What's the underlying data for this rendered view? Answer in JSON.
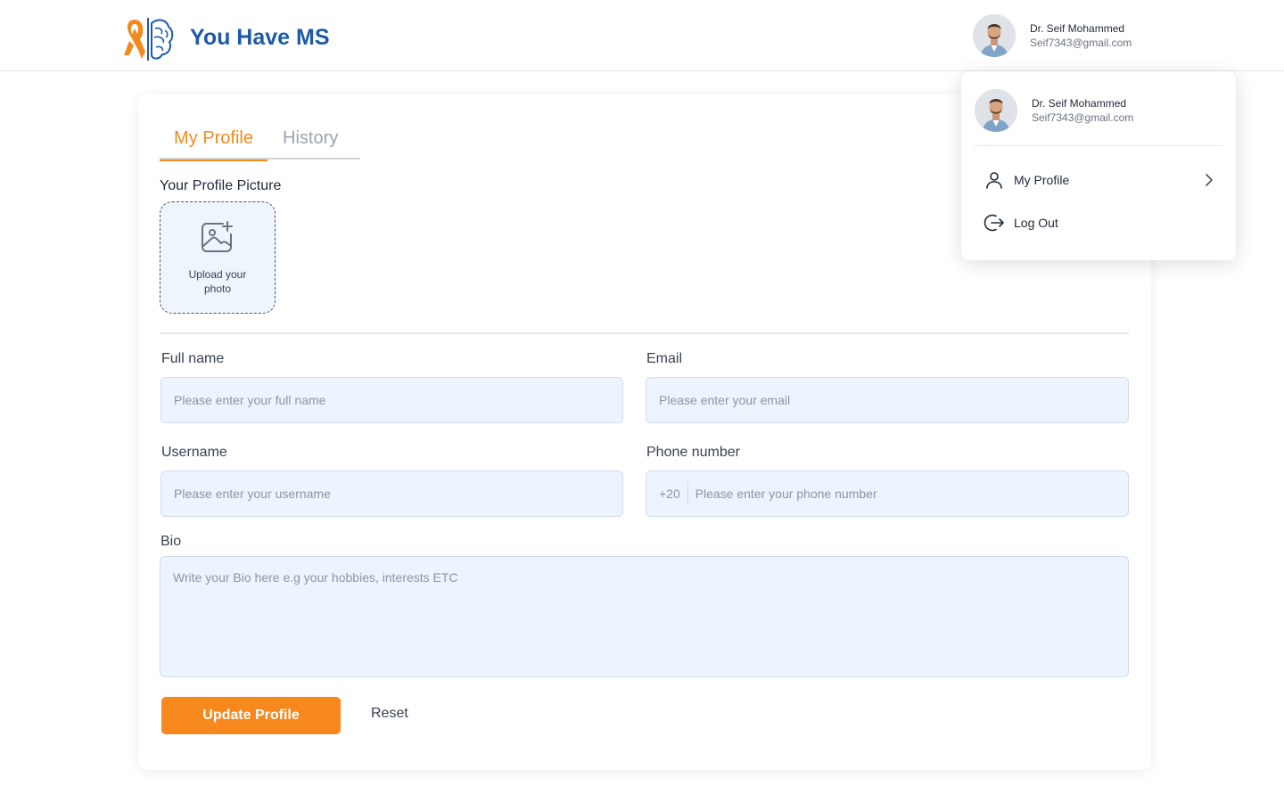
{
  "brand": {
    "name": "You Have MS",
    "ribbon_color": "#f28a1e",
    "brain_color": "#1e5aa8"
  },
  "user": {
    "name": "Dr. Seif Mohammed",
    "email": "Seif7343@gmail.com"
  },
  "tabs": [
    {
      "label": "My Profile",
      "active": true
    },
    {
      "label": "History",
      "active": false
    }
  ],
  "profile_picture": {
    "label": "Your Profile  Picture",
    "upload_text": "Upload your photo",
    "icon": "image-add-icon"
  },
  "form": {
    "full_name": {
      "label": "Full name",
      "placeholder": "Please enter your full name",
      "value": ""
    },
    "email": {
      "label": "Email",
      "placeholder": "Please enter your email",
      "value": ""
    },
    "username": {
      "label": "Username",
      "placeholder": "Please enter your username",
      "value": ""
    },
    "phone": {
      "label": "Phone number",
      "prefix": "+20",
      "placeholder": "Please enter your phone number",
      "value": ""
    },
    "bio": {
      "label": "Bio",
      "placeholder": "Write your Bio here e.g your hobbies, interests ETC",
      "value": ""
    }
  },
  "actions": {
    "update_label": "Update Profile",
    "reset_label": "Reset"
  },
  "dropdown": {
    "items": [
      {
        "label": "My Profile",
        "icon": "user-icon",
        "has_chevron": true
      },
      {
        "label": "Log Out",
        "icon": "logout-icon",
        "has_chevron": false
      }
    ]
  },
  "colors": {
    "accent": "#f7881d",
    "field_bg": "#eef4fd",
    "tab_inactive": "#9aa3af"
  }
}
